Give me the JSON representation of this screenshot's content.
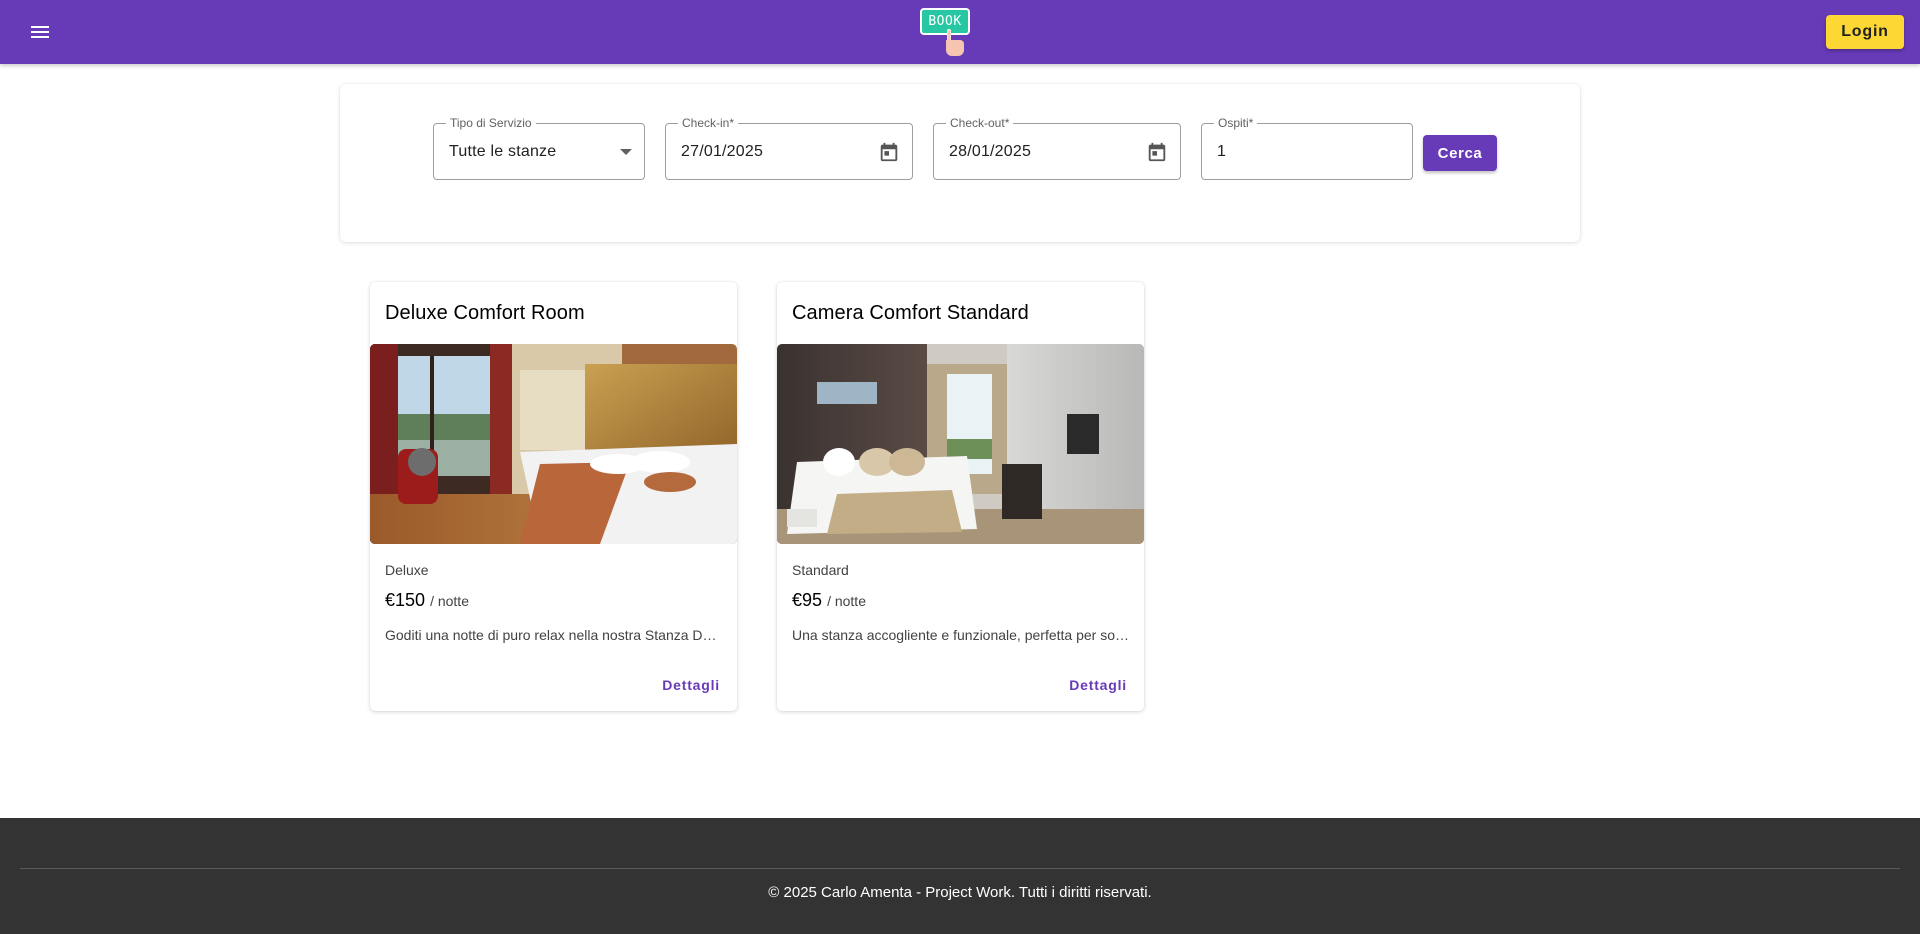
{
  "header": {
    "logo_text": "BOOK",
    "login_label": "Login"
  },
  "search": {
    "service": {
      "label": "Tipo di Servizio",
      "value": "Tutte le stanze"
    },
    "checkin": {
      "label": "Check-in*",
      "value": "27/01/2025"
    },
    "checkout": {
      "label": "Check-out*",
      "value": "28/01/2025"
    },
    "guests": {
      "label": "Ospiti*",
      "value": "1"
    },
    "submit_label": "Cerca"
  },
  "rooms": [
    {
      "title": "Deluxe Comfort Room",
      "category": "Deluxe",
      "price": "€150",
      "per_night": "/ notte",
      "description": "Goditi una notte di puro relax nella nostra Stanza Deluxe...",
      "details_label": "Dettagli"
    },
    {
      "title": "Camera Comfort Standard",
      "category": "Standard",
      "price": "€95",
      "per_night": "/ notte",
      "description": "Una stanza accogliente e funzionale, perfetta per soggiorni...",
      "details_label": "Dettagli"
    }
  ],
  "footer": {
    "copyright": "© 2025 Carlo Amenta - Project Work. Tutti i diritti riservati."
  },
  "colors": {
    "primary": "#673ab7",
    "accent": "#fdd835",
    "footer_bg": "#333333",
    "logo_teal": "#28c7a3"
  },
  "icons": [
    "menu-icon",
    "logo-hand-icon",
    "dropdown-arrow-icon",
    "calendar-icon"
  ]
}
